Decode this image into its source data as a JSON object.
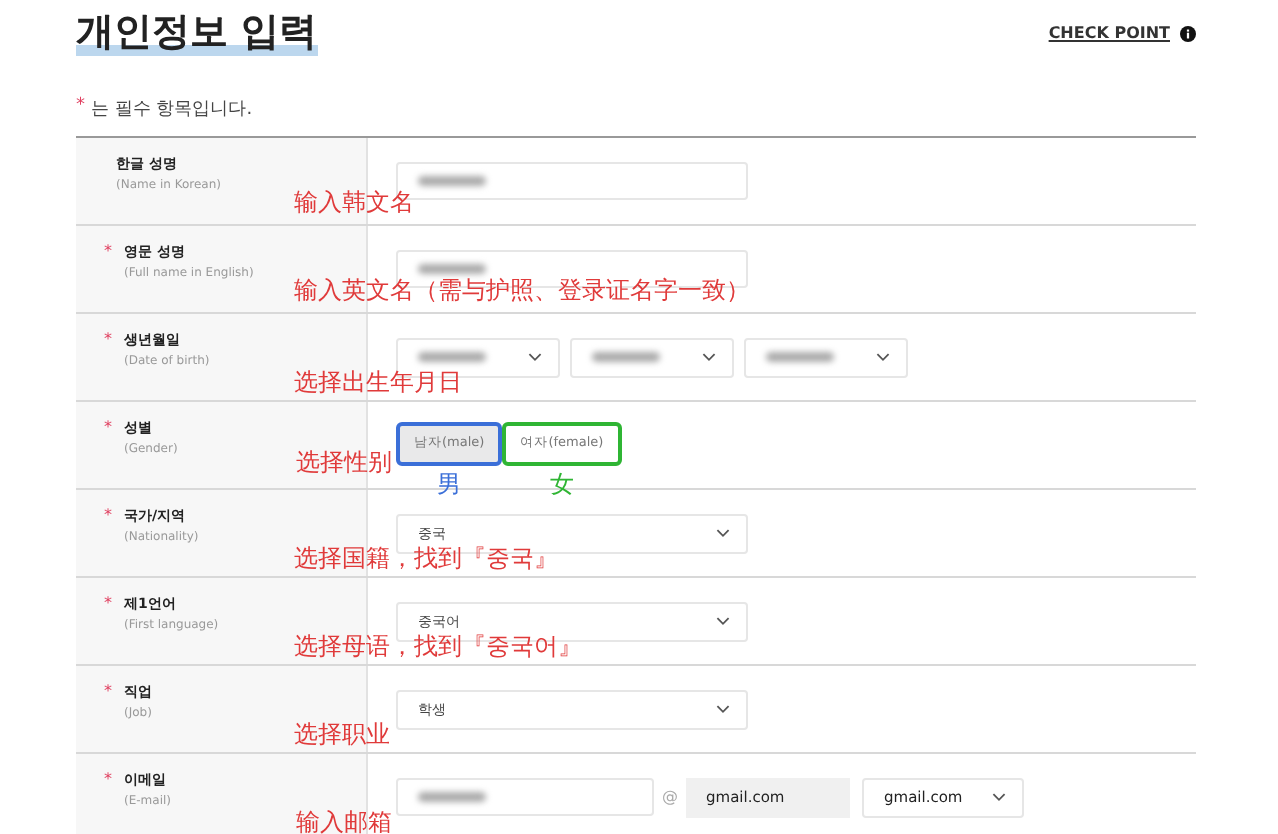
{
  "header": {
    "title": "개인정보 입력",
    "check_point": "CHECK POINT"
  },
  "required_note": {
    "mark": "*",
    "text": "는 필수 항목입니다."
  },
  "fields": [
    {
      "kind": "text",
      "label": "한글 성명",
      "label_en": "(Name in Korean)",
      "required": false,
      "blurred": true,
      "annotation": "输入韩文名"
    },
    {
      "kind": "text",
      "label": "영문 성명",
      "label_en": "(Full name in English)",
      "required": true,
      "blurred": true,
      "annotation": "输入英文名（需与护照、登录证名字一致）"
    },
    {
      "kind": "date",
      "label": "생년월일",
      "label_en": "(Date of birth)",
      "required": true,
      "selects": [
        {
          "blurred": true
        },
        {
          "blurred": true
        },
        {
          "blurred": true
        }
      ],
      "annotation": "选择出生年月日"
    },
    {
      "kind": "choice",
      "label": "성별",
      "label_en": "(Gender)",
      "required": true,
      "options": [
        {
          "label": "남자(male)",
          "selected": true,
          "note": "男",
          "color": "#3b6fd8"
        },
        {
          "label": "여자(female)",
          "selected": false,
          "note": "女",
          "color": "#2fb534"
        }
      ],
      "annotation": "选择性别"
    },
    {
      "kind": "select",
      "label": "국가/지역",
      "label_en": "(Nationality)",
      "required": true,
      "value": "중국",
      "annotation": "选择国籍，找到『중국』"
    },
    {
      "kind": "select",
      "label": "제1언어",
      "label_en": "(First language)",
      "required": true,
      "value": "중국어",
      "annotation": "选择母语，找到『중국어』"
    },
    {
      "kind": "select",
      "label": "직업",
      "label_en": "(Job)",
      "required": true,
      "value": "학생",
      "annotation": "选择职业"
    },
    {
      "kind": "email",
      "label": "이메일",
      "label_en": "(E-mail)",
      "required": true,
      "blurred": true,
      "at": "@",
      "domain": "gmail.com",
      "domain_select": "gmail.com",
      "annotation": "输入邮箱"
    }
  ]
}
